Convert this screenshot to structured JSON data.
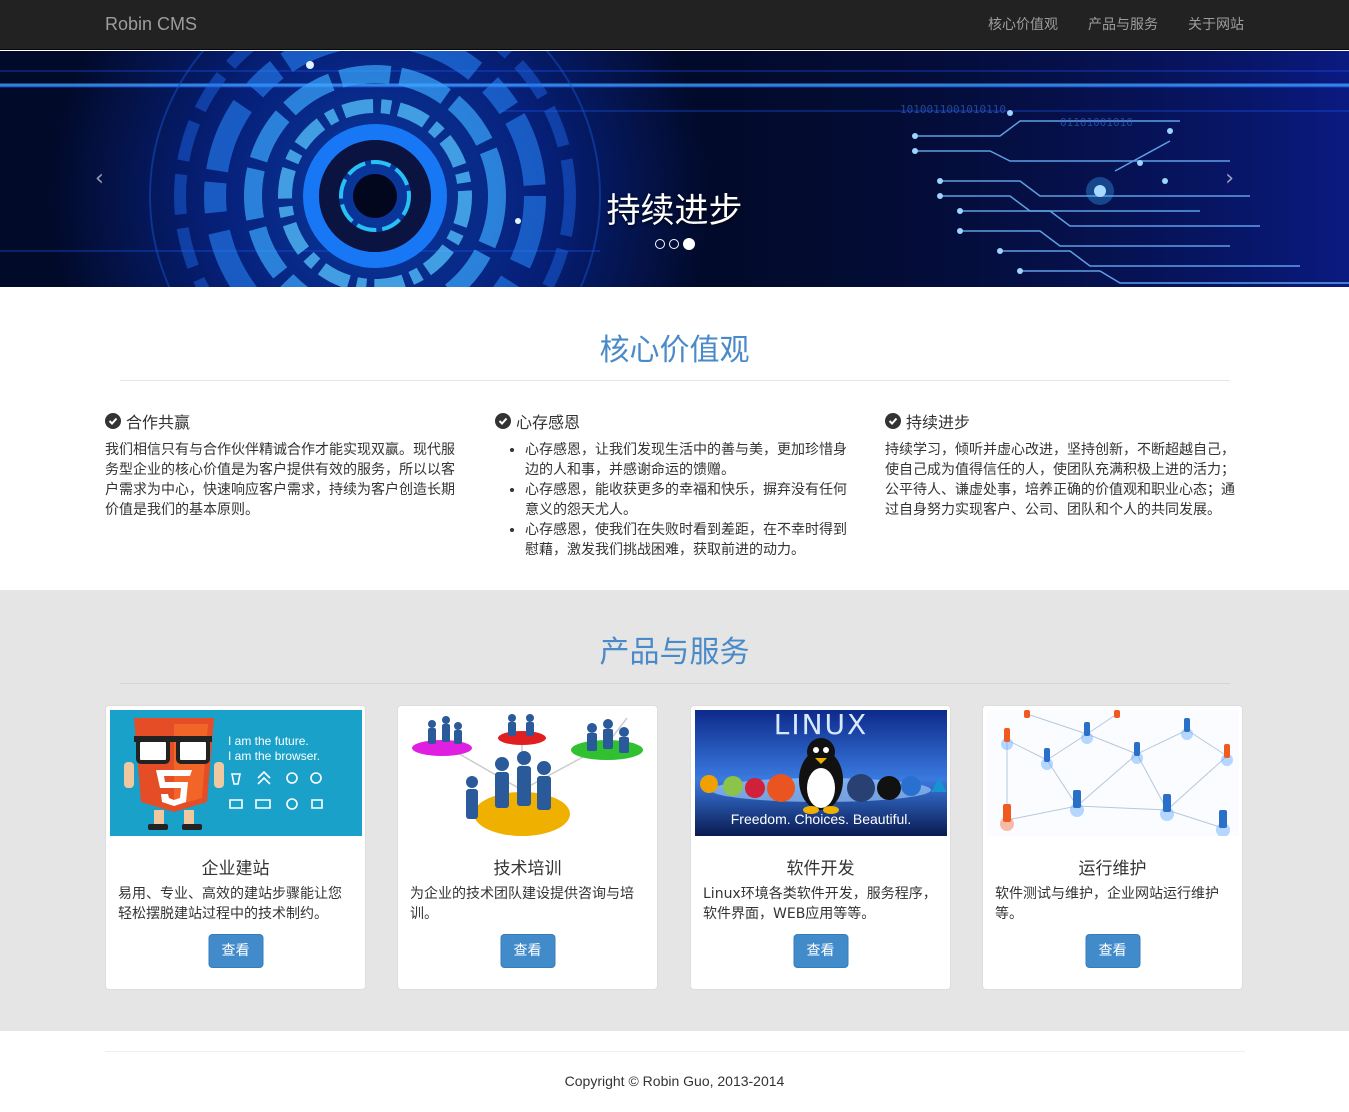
{
  "navbar": {
    "brand": "Robin CMS",
    "items": [
      {
        "label": "核心价值观"
      },
      {
        "label": "产品与服务"
      },
      {
        "label": "关于网站"
      }
    ]
  },
  "carousel": {
    "caption": "持续进步",
    "prev_icon": "chevron-left-icon",
    "next_icon": "chevron-right-icon",
    "indicator_count": 3,
    "active_index": 2
  },
  "values": {
    "title": "核心价值观",
    "cols": [
      {
        "heading": "合作共赢",
        "text": "我们相信只有与合作伙伴精诚合作才能实现双赢。现代服务型企业的核心价值是为客户提供有效的服务，所以以客户需求为中心，快速响应客户需求，持续为客户创造长期价值是我们的基本原则。"
      },
      {
        "heading": "心存感恩",
        "items": [
          "心存感恩，让我们发现生活中的善与美，更加珍惜身边的人和事，并感谢命运的馈赠。",
          "心存感恩，能收获更多的幸福和快乐，摒弃没有任何意义的怨天尤人。",
          "心存感恩，使我们在失败时看到差距，在不幸时得到慰藉，激发我们挑战困难，获取前进的动力。"
        ]
      },
      {
        "heading": "持续进步",
        "text": "持续学习，倾听并虚心改进，坚持创新，不断超越自己，使自己成为值得信任的人，使团队充满积极上进的活力；公平待人、谦虚处事，培养正确的价值观和职业心态；通过自身努力实现客户、公司、团队和个人的共同发展。"
      }
    ]
  },
  "products": {
    "title": "产品与服务",
    "cards": [
      {
        "title": "企业建站",
        "text": "易用、专业、高效的建站步骤能让您轻松摆脱建站过程中的技术制约。",
        "button": "查看",
        "image_line1": "I am the future.",
        "image_line2": "I am the browser."
      },
      {
        "title": "技术培训",
        "text": "为企业的技术团队建设提供咨询与培训。",
        "button": "查看"
      },
      {
        "title": "软件开发",
        "text": "Linux环境各类软件开发，服务程序，软件界面，WEB应用等等。",
        "button": "查看",
        "image_title": "LINUX",
        "image_tagline": "Freedom. Choices. Beautiful."
      },
      {
        "title": "运行维护",
        "text": "软件测试与维护，企业网站运行维护等。",
        "button": "查看"
      }
    ]
  },
  "footer": {
    "copyright": "Copyright © Robin Guo, 2013-2014"
  },
  "colors": {
    "navbar_bg": "#222222",
    "accent_title": "#4a8ac9",
    "button": "#428bca",
    "products_bg": "#e5e5e5"
  }
}
